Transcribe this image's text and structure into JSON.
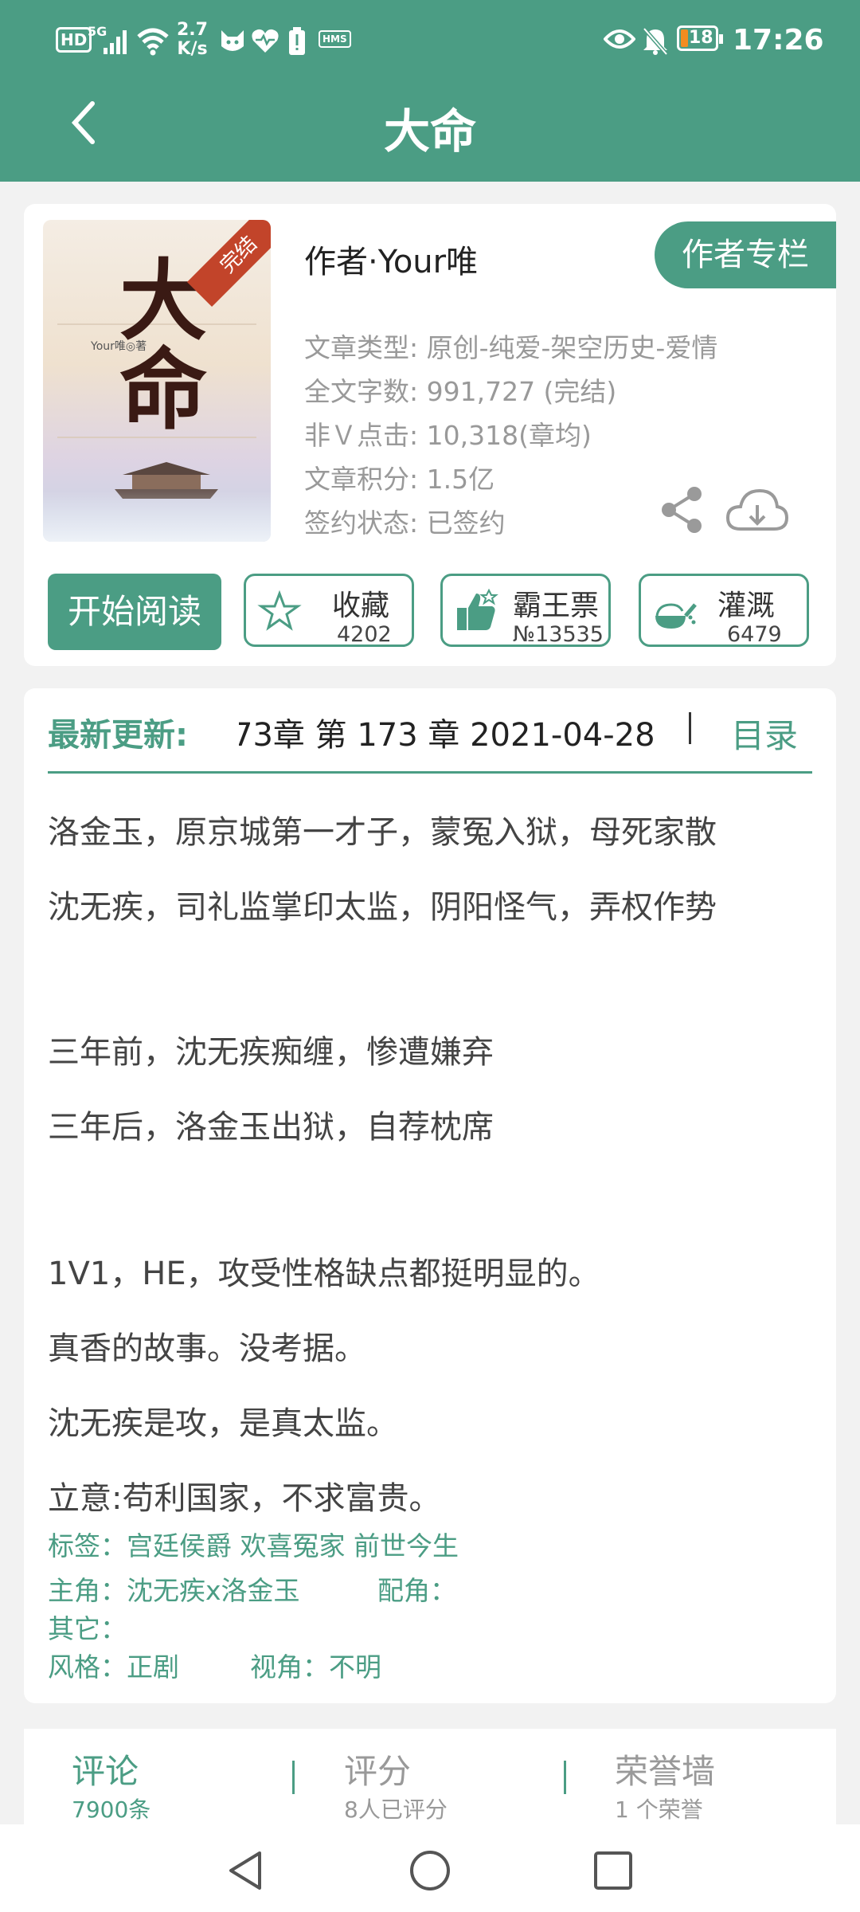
{
  "status_bar": {
    "hd": "HD",
    "network": "5G",
    "speed_value": "2.7",
    "speed_unit": "K/s",
    "hms": "HMS",
    "battery": "18",
    "time": "17:26"
  },
  "header": {
    "title": "大命"
  },
  "book": {
    "cover_badge": "完结",
    "cover_title": "大命",
    "cover_author": "Your唯◎著",
    "author": "作者·Your唯",
    "author_column_button": "作者专栏",
    "type": "文章类型: 原创-纯爱-架空历史-爱情",
    "words": "全文字数: 991,727 (完结)",
    "clicks": "非Ｖ点击: 10,318(章均)",
    "score": "文章积分: 1.5亿",
    "sign": "签约状态: 已签约"
  },
  "actions": {
    "read": "开始阅读",
    "collect_label": "收藏",
    "collect_count": "4202",
    "vote_label": "霸王票",
    "vote_count": "№13535",
    "water_label": "灌溉",
    "water_count": "6479"
  },
  "latest": {
    "label": "最新更新:",
    "text": "73章  第 173 章  2021-04-28",
    "catalog": "目录"
  },
  "description": [
    "洛金玉，原京城第一才子，蒙冤入狱，母死家散",
    "沈无疾，司礼监掌印太监，阴阳怪气，弄权作势",
    "三年前，沈无疾痴缠，惨遭嫌弃",
    "三年后，洛金玉出狱，自荐枕席",
    "1V1，HE，攻受性格缺点都挺明显的。",
    "真香的故事。没考据。",
    "沈无疾是攻，是真太监。",
    "立意:苟利国家，不求富贵。"
  ],
  "tags": {
    "tags_line": "标签：宫廷侯爵  欢喜冤家  前世今生",
    "main_roles": "主角：沈无疾x洛金玉",
    "support_roles": "配角：",
    "others": "其它：",
    "style": "风格：正剧",
    "view": "视角：不明"
  },
  "tabs": [
    {
      "title": "评论",
      "sub": "7900条"
    },
    {
      "title": "评分",
      "sub": "8人已评分"
    },
    {
      "title": "荣誉墙",
      "sub": "1 个荣誉"
    }
  ],
  "colors": {
    "accent": "#4b9d84",
    "badge": "#c2442a"
  },
  "icons": [
    "back-arrow-icon",
    "share-icon",
    "cloud-download-icon",
    "star-icon",
    "thumbs-up-icon",
    "watering-icon",
    "nav-back-icon",
    "nav-home-icon",
    "nav-recent-icon"
  ]
}
